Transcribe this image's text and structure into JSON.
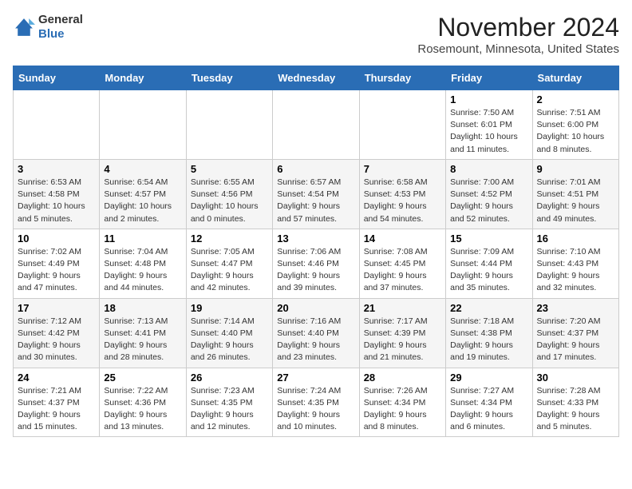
{
  "header": {
    "logo_line1": "General",
    "logo_line2": "Blue",
    "month": "November 2024",
    "location": "Rosemount, Minnesota, United States"
  },
  "weekdays": [
    "Sunday",
    "Monday",
    "Tuesday",
    "Wednesday",
    "Thursday",
    "Friday",
    "Saturday"
  ],
  "weeks": [
    [
      {
        "day": "",
        "info": ""
      },
      {
        "day": "",
        "info": ""
      },
      {
        "day": "",
        "info": ""
      },
      {
        "day": "",
        "info": ""
      },
      {
        "day": "",
        "info": ""
      },
      {
        "day": "1",
        "info": "Sunrise: 7:50 AM\nSunset: 6:01 PM\nDaylight: 10 hours and 11 minutes."
      },
      {
        "day": "2",
        "info": "Sunrise: 7:51 AM\nSunset: 6:00 PM\nDaylight: 10 hours and 8 minutes."
      }
    ],
    [
      {
        "day": "3",
        "info": "Sunrise: 6:53 AM\nSunset: 4:58 PM\nDaylight: 10 hours and 5 minutes."
      },
      {
        "day": "4",
        "info": "Sunrise: 6:54 AM\nSunset: 4:57 PM\nDaylight: 10 hours and 2 minutes."
      },
      {
        "day": "5",
        "info": "Sunrise: 6:55 AM\nSunset: 4:56 PM\nDaylight: 10 hours and 0 minutes."
      },
      {
        "day": "6",
        "info": "Sunrise: 6:57 AM\nSunset: 4:54 PM\nDaylight: 9 hours and 57 minutes."
      },
      {
        "day": "7",
        "info": "Sunrise: 6:58 AM\nSunset: 4:53 PM\nDaylight: 9 hours and 54 minutes."
      },
      {
        "day": "8",
        "info": "Sunrise: 7:00 AM\nSunset: 4:52 PM\nDaylight: 9 hours and 52 minutes."
      },
      {
        "day": "9",
        "info": "Sunrise: 7:01 AM\nSunset: 4:51 PM\nDaylight: 9 hours and 49 minutes."
      }
    ],
    [
      {
        "day": "10",
        "info": "Sunrise: 7:02 AM\nSunset: 4:49 PM\nDaylight: 9 hours and 47 minutes."
      },
      {
        "day": "11",
        "info": "Sunrise: 7:04 AM\nSunset: 4:48 PM\nDaylight: 9 hours and 44 minutes."
      },
      {
        "day": "12",
        "info": "Sunrise: 7:05 AM\nSunset: 4:47 PM\nDaylight: 9 hours and 42 minutes."
      },
      {
        "day": "13",
        "info": "Sunrise: 7:06 AM\nSunset: 4:46 PM\nDaylight: 9 hours and 39 minutes."
      },
      {
        "day": "14",
        "info": "Sunrise: 7:08 AM\nSunset: 4:45 PM\nDaylight: 9 hours and 37 minutes."
      },
      {
        "day": "15",
        "info": "Sunrise: 7:09 AM\nSunset: 4:44 PM\nDaylight: 9 hours and 35 minutes."
      },
      {
        "day": "16",
        "info": "Sunrise: 7:10 AM\nSunset: 4:43 PM\nDaylight: 9 hours and 32 minutes."
      }
    ],
    [
      {
        "day": "17",
        "info": "Sunrise: 7:12 AM\nSunset: 4:42 PM\nDaylight: 9 hours and 30 minutes."
      },
      {
        "day": "18",
        "info": "Sunrise: 7:13 AM\nSunset: 4:41 PM\nDaylight: 9 hours and 28 minutes."
      },
      {
        "day": "19",
        "info": "Sunrise: 7:14 AM\nSunset: 4:40 PM\nDaylight: 9 hours and 26 minutes."
      },
      {
        "day": "20",
        "info": "Sunrise: 7:16 AM\nSunset: 4:40 PM\nDaylight: 9 hours and 23 minutes."
      },
      {
        "day": "21",
        "info": "Sunrise: 7:17 AM\nSunset: 4:39 PM\nDaylight: 9 hours and 21 minutes."
      },
      {
        "day": "22",
        "info": "Sunrise: 7:18 AM\nSunset: 4:38 PM\nDaylight: 9 hours and 19 minutes."
      },
      {
        "day": "23",
        "info": "Sunrise: 7:20 AM\nSunset: 4:37 PM\nDaylight: 9 hours and 17 minutes."
      }
    ],
    [
      {
        "day": "24",
        "info": "Sunrise: 7:21 AM\nSunset: 4:37 PM\nDaylight: 9 hours and 15 minutes."
      },
      {
        "day": "25",
        "info": "Sunrise: 7:22 AM\nSunset: 4:36 PM\nDaylight: 9 hours and 13 minutes."
      },
      {
        "day": "26",
        "info": "Sunrise: 7:23 AM\nSunset: 4:35 PM\nDaylight: 9 hours and 12 minutes."
      },
      {
        "day": "27",
        "info": "Sunrise: 7:24 AM\nSunset: 4:35 PM\nDaylight: 9 hours and 10 minutes."
      },
      {
        "day": "28",
        "info": "Sunrise: 7:26 AM\nSunset: 4:34 PM\nDaylight: 9 hours and 8 minutes."
      },
      {
        "day": "29",
        "info": "Sunrise: 7:27 AM\nSunset: 4:34 PM\nDaylight: 9 hours and 6 minutes."
      },
      {
        "day": "30",
        "info": "Sunrise: 7:28 AM\nSunset: 4:33 PM\nDaylight: 9 hours and 5 minutes."
      }
    ]
  ],
  "accent_color": "#2a6db5"
}
